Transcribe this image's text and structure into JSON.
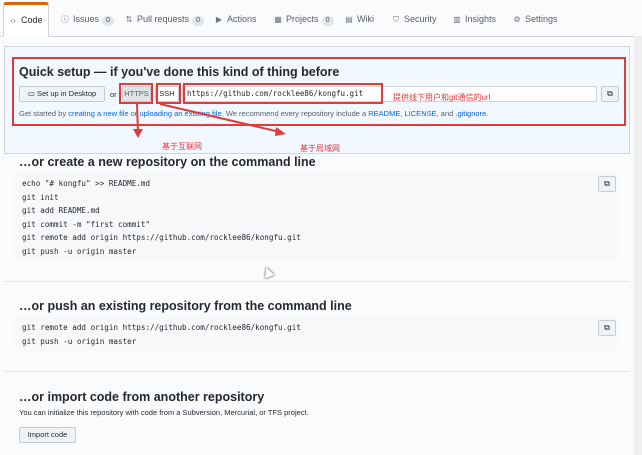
{
  "tabs": [
    {
      "label": "Code",
      "icon": "code-icon",
      "glyph": "‹›",
      "active": true
    },
    {
      "label": "Issues",
      "icon": "issue-icon",
      "glyph": "ⓘ",
      "count": "0"
    },
    {
      "label": "Pull requests",
      "icon": "pull-request-icon",
      "glyph": "⇅",
      "count": "0"
    },
    {
      "label": "Actions",
      "icon": "play-icon",
      "glyph": "▶"
    },
    {
      "label": "Projects",
      "icon": "project-icon",
      "glyph": "▦",
      "count": "0"
    },
    {
      "label": "Wiki",
      "icon": "book-icon",
      "glyph": "▤"
    },
    {
      "label": "Security",
      "icon": "shield-icon",
      "glyph": "⛉"
    },
    {
      "label": "Insights",
      "icon": "graph-icon",
      "glyph": "▥"
    },
    {
      "label": "Settings",
      "icon": "gear-icon",
      "glyph": "⚙"
    }
  ],
  "quick_setup": {
    "title": "Quick setup — if you've done this kind of thing before",
    "desktop_button": "Set up in Desktop",
    "desktop_icon": "desktop-icon",
    "or": "or",
    "https": "HTTPS",
    "ssh": "SSH",
    "url": "https://github.com/rocklee86/kongfu.git",
    "copy_icon": "clipboard-icon",
    "hint": {
      "prefix": "Get started by ",
      "link1": "creating a new file",
      "mid1": " or ",
      "link2": "uploading an existing file",
      "mid2": ". We recommend every repository include a ",
      "link3": "README",
      "sep1": ", ",
      "link4": "LICENSE",
      "sep2": ", and ",
      "link5": ".gitignore",
      "suffix": "."
    }
  },
  "annotations": {
    "url_note": "提供线下用户和git通信的url",
    "https_note": "基于互联网",
    "ssh_note": "基于局域网",
    "color": "#e03b3b"
  },
  "create_section": {
    "title": "…or create a new repository on the command line",
    "code": "echo \"# kongfu\" >> README.md\ngit init\ngit add README.md\ngit commit -m \"first commit\"\ngit remote add origin https://github.com/rocklee86/kongfu.git\ngit push -u origin master"
  },
  "push_section": {
    "title": "…or push an existing repository from the command line",
    "code": "git remote add origin https://github.com/rocklee86/kongfu.git\ngit push -u origin master"
  },
  "import_section": {
    "title": "…or import code from another repository",
    "desc": "You can initialize this repository with code from a Subversion, Mercurial, or TFS project.",
    "button": "Import code"
  }
}
